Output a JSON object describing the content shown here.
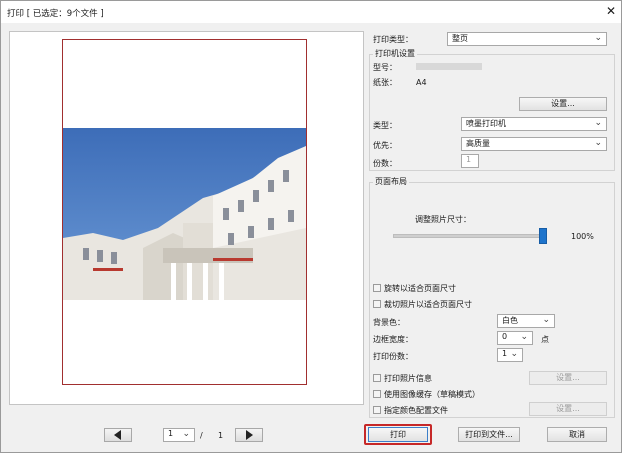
{
  "window": {
    "title": "打印 [ 已选定：9个文件 ]"
  },
  "top": {
    "printer_type_label": "打印类型：",
    "printer_type_value": "整页",
    "printer_settings_label": "打印机设置",
    "model_label": "型号：",
    "paper_label": "纸张：",
    "paper_value": "A4",
    "settings_btn": "设置..."
  },
  "type": {
    "label": "类型：",
    "value": "喷墨打印机"
  },
  "priority": {
    "label": "优先：",
    "value": "高质量"
  },
  "copies": {
    "label": "份数：",
    "value": "1"
  },
  "layout": {
    "group_label": "页面布局",
    "adjust_label": "调整照片尺寸：",
    "zoom_value": 1.0,
    "zoom_text": "100%",
    "rotate_label": "旋转以适合页面尺寸",
    "crop_label": "裁切照片以适合页面尺寸",
    "bg_label": "背景色：",
    "bg_value": "白色",
    "border_label": "边框宽度：",
    "border_value": "0",
    "border_unit": "点",
    "print_copies_label": "打印份数：",
    "print_copies_value": "1"
  },
  "options": {
    "print_info_label": "打印照片信息",
    "print_info_btn": "设置...",
    "cache_label": "使用图像缓存（草稿模式）",
    "color_profile_label": "指定颜色配置文件",
    "color_profile_btn": "设置..."
  },
  "nav": {
    "page_value": "1",
    "sep": "/",
    "total": "1"
  },
  "buttons": {
    "print": "打印",
    "print_to_file": "打印到文件...",
    "cancel": "取消"
  },
  "colors": {
    "accent": "#1e74cc",
    "page_border": "#a12f2f",
    "print_highlight": "#c62828"
  }
}
